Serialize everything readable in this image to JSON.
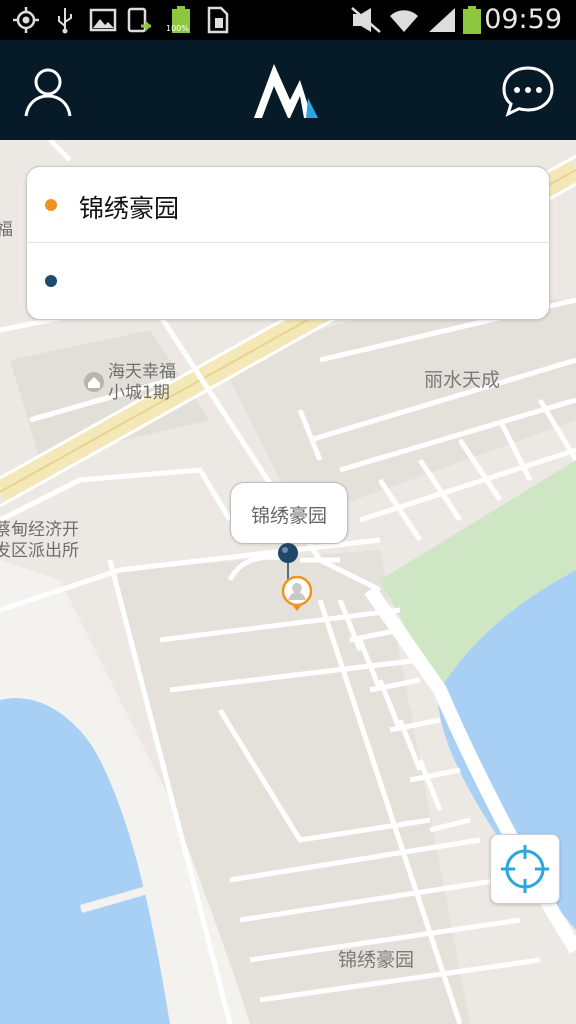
{
  "status_bar": {
    "time": "09:59",
    "battery_percent_label": "100%",
    "icons": [
      "gps-icon",
      "usb-icon",
      "gallery-icon",
      "download-icon",
      "battery-full-icon",
      "sim-icon",
      "mute-icon",
      "wifi-icon",
      "signal-icon",
      "battery-icon"
    ]
  },
  "app_bar": {
    "profile_icon": "person-icon",
    "logo_icon": "app-logo",
    "chat_icon": "chat-bubble-icon",
    "background_color": "#071a28",
    "accent_color": "#2aa7df"
  },
  "route": {
    "from_text": "锦绣豪园",
    "to_text": "",
    "from_dot_color": "#f0921e",
    "to_dot_color": "#1e4a6e"
  },
  "map": {
    "labels": {
      "fu": "福",
      "haitian_line1": "海天幸福",
      "haitian_line2": "小城1期",
      "lishui": "丽水天成",
      "police_line1": "蔡甸经济开",
      "police_line2": "发区派出所",
      "jinxiu_bottom": "锦绣豪园"
    },
    "bubble_text": "锦绣豪园",
    "water_color": "#a8cff4",
    "park_color": "#cfe6c4"
  },
  "locate_button": {
    "icon": "crosshair-icon"
  }
}
